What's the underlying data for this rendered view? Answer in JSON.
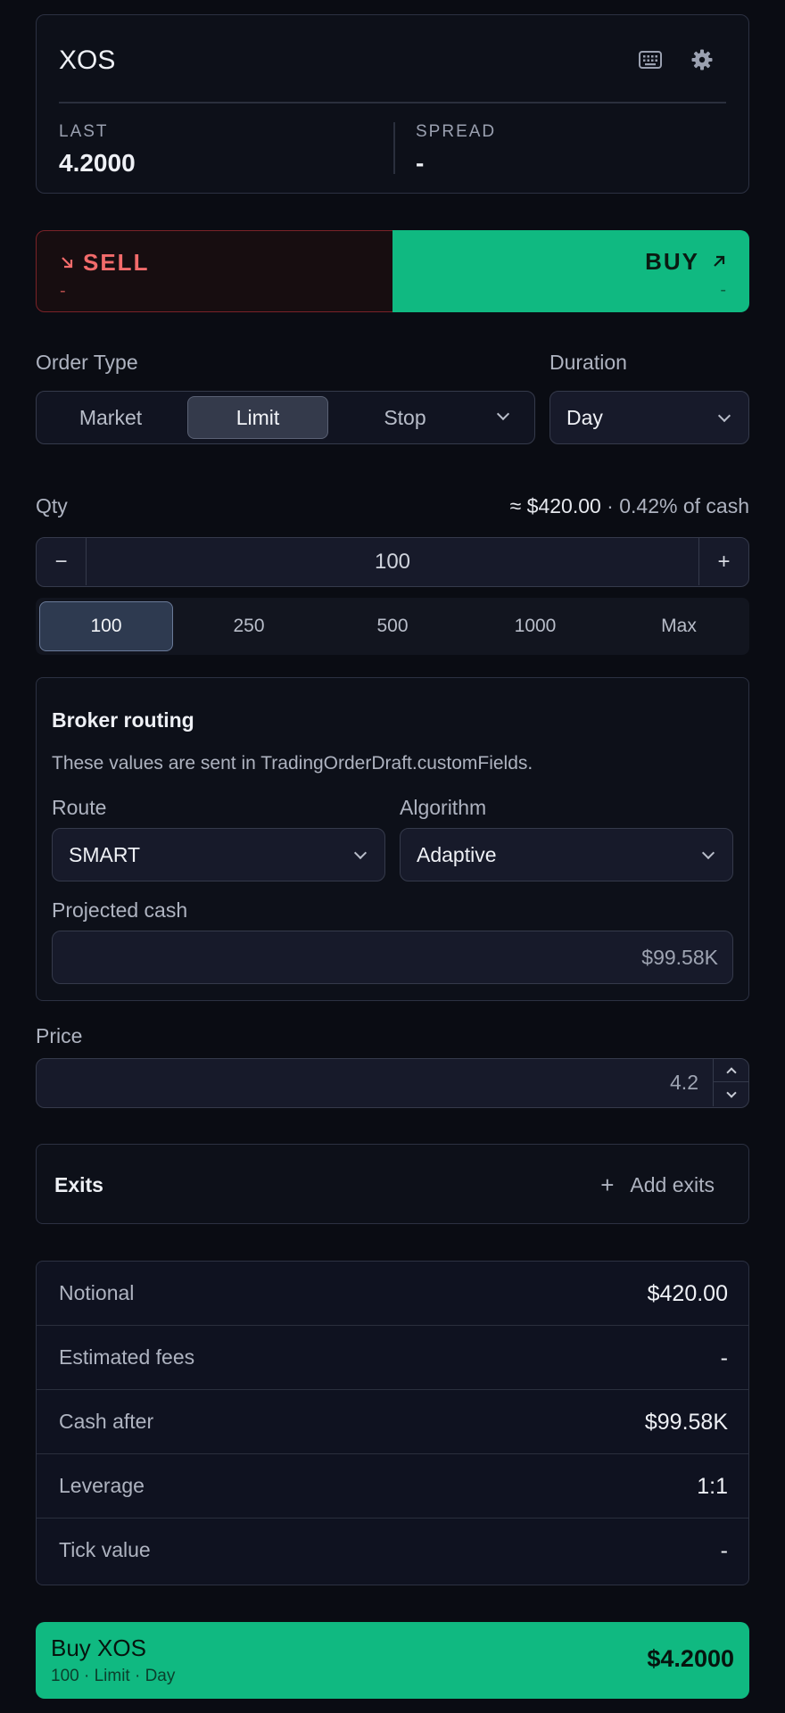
{
  "header": {
    "symbol": "XOS",
    "icons": [
      "keyboard-icon",
      "gear-icon"
    ],
    "last_label": "LAST",
    "last_value": "4.2000",
    "spread_label": "SPREAD",
    "spread_value": "-"
  },
  "side": {
    "sell_label": "SELL",
    "sell_sub": "-",
    "buy_label": "BUY",
    "buy_sub": "-",
    "selected": "BUY"
  },
  "order_type": {
    "label": "Order Type",
    "options": [
      "Market",
      "Limit",
      "Stop"
    ],
    "selected": "Limit"
  },
  "duration": {
    "label": "Duration",
    "value": "Day"
  },
  "qty": {
    "label": "Qty",
    "hint_value": "≈ $420.00",
    "hint_extra": " · 0.42% of cash",
    "minus": "−",
    "plus": "+",
    "value": "100",
    "presets": [
      "100",
      "250",
      "500",
      "1000",
      "Max"
    ],
    "selected_preset": "100"
  },
  "broker": {
    "title": "Broker routing",
    "description": "These values are sent in TradingOrderDraft.customFields.",
    "route_label": "Route",
    "route_value": "SMART",
    "algorithm_label": "Algorithm",
    "algorithm_value": "Adaptive",
    "projected_label": "Projected cash",
    "projected_value": "$99.58K"
  },
  "price": {
    "label": "Price",
    "value": "4.2"
  },
  "exits": {
    "title": "Exits",
    "add_label": "Add exits",
    "add_icon": "+"
  },
  "summary": [
    {
      "label": "Notional",
      "value": "$420.00"
    },
    {
      "label": "Estimated fees",
      "value": "-"
    },
    {
      "label": "Cash after",
      "value": "$99.58K"
    },
    {
      "label": "Leverage",
      "value": "1:1"
    },
    {
      "label": "Tick value",
      "value": "-"
    }
  ],
  "submit": {
    "title": "Buy XOS",
    "meta": "100 · Limit · Day",
    "amount": "$4.2000"
  },
  "colors": {
    "buy": "#10b981",
    "sell": "#f26b6b",
    "background": "#0a0c13"
  }
}
